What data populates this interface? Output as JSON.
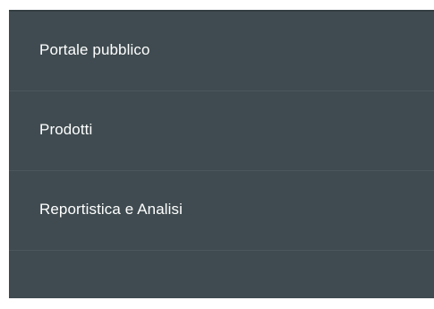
{
  "menu": {
    "items": [
      {
        "label": "Portale pubblico"
      },
      {
        "label": "Prodotti"
      },
      {
        "label": "Reportistica e Analisi"
      }
    ]
  },
  "colors": {
    "panel_background": "#3f4b50",
    "divider": "#4b575c",
    "text": "#ffffff"
  }
}
